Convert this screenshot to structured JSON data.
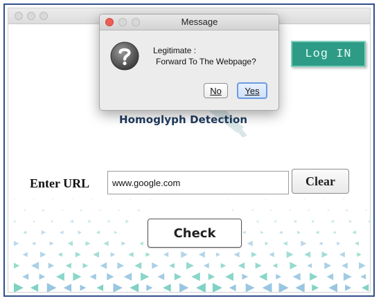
{
  "main_window": {
    "login_button": "Log IN",
    "app_title": "Homoglyph Detection",
    "url_label": "Enter URL",
    "url_value": "www.google.com",
    "clear_button": "Clear",
    "check_button": "Check"
  },
  "dialog": {
    "title": "Message",
    "message_line1": "Legitimate :",
    "message_line2": "Forward To The Webpage?",
    "no_button": "No",
    "yes_button": "Yes"
  },
  "colors": {
    "accent_teal": "#2e9b86",
    "heading_navy": "#1f3a5f",
    "frame_blue": "#2f4f8a",
    "traffic_close": "#ec5f57",
    "traffic_minimize": "#d8d8d8",
    "traffic_zoom": "#d8d8d8"
  },
  "icons": {
    "dialog_icon": "question-icon",
    "window_controls": [
      "close-dot",
      "minimize-dot",
      "zoom-dot"
    ]
  }
}
